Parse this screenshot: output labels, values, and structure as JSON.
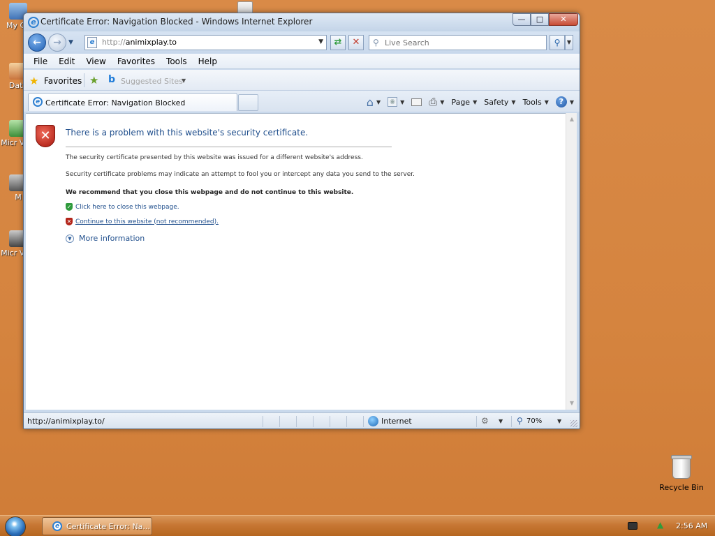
{
  "desktop": {
    "icons": [
      {
        "label": "My Co"
      },
      {
        "label": "Data"
      },
      {
        "label": "Micr Visu"
      },
      {
        "label": "M"
      },
      {
        "label": "Micr Visu"
      },
      {
        "label": ""
      }
    ],
    "recycle_bin": "Recycle Bin"
  },
  "window": {
    "title": "Certificate Error: Navigation Blocked - Windows Internet Explorer",
    "controls": {
      "minimize": "—",
      "maximize": "□",
      "close": "✕"
    }
  },
  "navbar": {
    "address_protocol": "http://",
    "address_host": "animixplay.to",
    "search_placeholder": "Live Search"
  },
  "menu": [
    "File",
    "Edit",
    "View",
    "Favorites",
    "Tools",
    "Help"
  ],
  "favorites_bar": {
    "favorites_label": "Favorites",
    "suggested_label": "Suggested Sites"
  },
  "tab": {
    "label": "Certificate Error: Navigation Blocked"
  },
  "command_bar": {
    "page": "Page",
    "safety": "Safety",
    "tools": "Tools"
  },
  "page": {
    "heading": "There is a problem with this website's security certificate.",
    "para1": "The security certificate presented by this website was issued for a different website's address.",
    "para2": "Security certificate problems may indicate an attempt to fool you or intercept any data you send to the server.",
    "recommendation": "We recommend that you close this webpage and do not continue to this website.",
    "close_link": "Click here to close this webpage.",
    "continue_link": "Continue to this website (not recommended).",
    "more_info": "More information"
  },
  "status_bar": {
    "url": "http://animixplay.to/",
    "zone": "Internet",
    "zoom": "70%"
  },
  "taskbar": {
    "task_label": "Certificate Error: Na...",
    "clock": "2:56 AM"
  }
}
